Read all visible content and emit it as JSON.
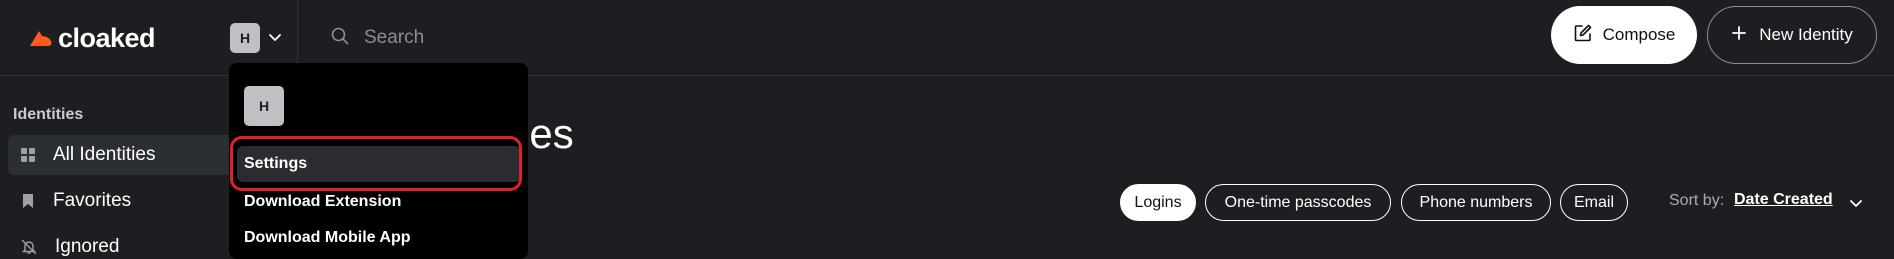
{
  "app": {
    "name": "cloaked",
    "brand_color": "#ff5a1f"
  },
  "topbar": {
    "account_initial": "H",
    "search_placeholder": "Search",
    "compose_label": "Compose",
    "new_identity_label": "New Identity"
  },
  "sidebar": {
    "heading": "Identities",
    "items": [
      {
        "label": "All Identities",
        "icon": "grid-icon",
        "active": true
      },
      {
        "label": "Favorites",
        "icon": "bookmark-icon",
        "active": false
      },
      {
        "label": "Ignored",
        "icon": "bell-off-icon",
        "active": false
      }
    ]
  },
  "main": {
    "title_visible": "ies",
    "filters": [
      {
        "label": "Logins",
        "active": true
      },
      {
        "label": "One-time passcodes",
        "active": false
      },
      {
        "label": "Phone numbers",
        "active": false
      },
      {
        "label": "Email",
        "active": false
      }
    ],
    "sort_label": "Sort by:",
    "sort_value": "Date Created"
  },
  "dropdown": {
    "initial": "H",
    "items": [
      {
        "label": "Settings",
        "highlighted": true
      },
      {
        "label": "Download Extension",
        "highlighted": false
      },
      {
        "label": "Download Mobile App",
        "highlighted": false
      }
    ],
    "annotation_color": "#e0202a"
  }
}
